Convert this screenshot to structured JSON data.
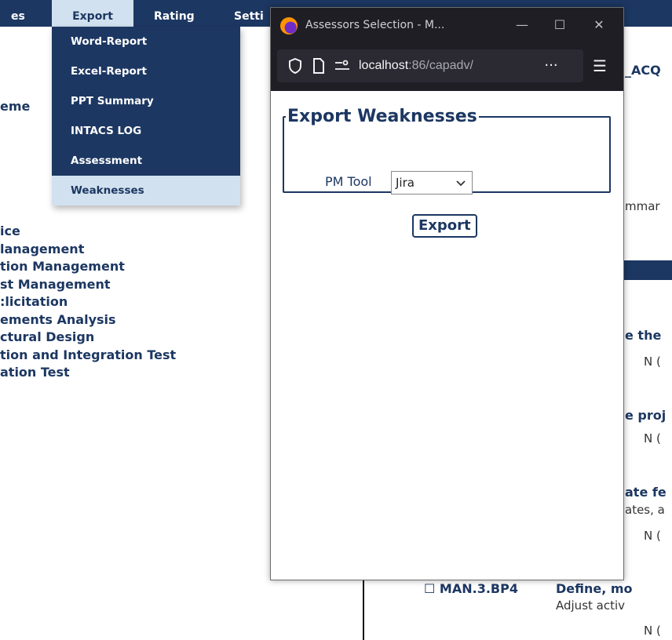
{
  "topnav": {
    "items": [
      {
        "label": "es"
      },
      {
        "label": "Export"
      },
      {
        "label": "Rating"
      },
      {
        "label": "Setti"
      }
    ]
  },
  "export_menu": {
    "items": [
      {
        "label": "Word-Report"
      },
      {
        "label": "Excel-Report"
      },
      {
        "label": "PPT Summary"
      },
      {
        "label": "INTACS LOG"
      },
      {
        "label": "Assessment"
      },
      {
        "label": "Weaknesses"
      }
    ]
  },
  "background": {
    "left_fragment": "eme",
    "left_list": [
      "ice",
      "lanagement",
      "tion Management",
      "st Management",
      ":licitation",
      "ements Analysis",
      "ctural Design",
      "tion and Integration Test",
      "ation Test"
    ],
    "right": {
      "acq": "_ACQ",
      "summary": "mmar",
      "item1_title": "e the",
      "item1_n": "N (",
      "item2_title": "e proj",
      "item2_n": "N (",
      "item3_title": "ate fe",
      "item3_desc": "ates, a",
      "item3_n": "N (",
      "bp4_code": "☐ MAN.3.BP4",
      "bp4_title": "Define, mo",
      "bp4_desc": "Adjust activ",
      "bp4_n": "N ("
    }
  },
  "popup": {
    "title": "Assessors Selection - M...",
    "controls": {
      "minimize": "—",
      "maximize": "☐",
      "close": "✕"
    },
    "url_host": "localhost",
    "url_rest": ":86/capadv/",
    "more": "···",
    "menu": "☰",
    "legend": "Export Weaknesses",
    "pm_label": "PM Tool",
    "pm_value": "Jira",
    "export_label": "Export"
  },
  "colors": {
    "navy": "#1c3762",
    "highlight": "#d2e1ef",
    "browser_chrome": "#1f1e25"
  }
}
